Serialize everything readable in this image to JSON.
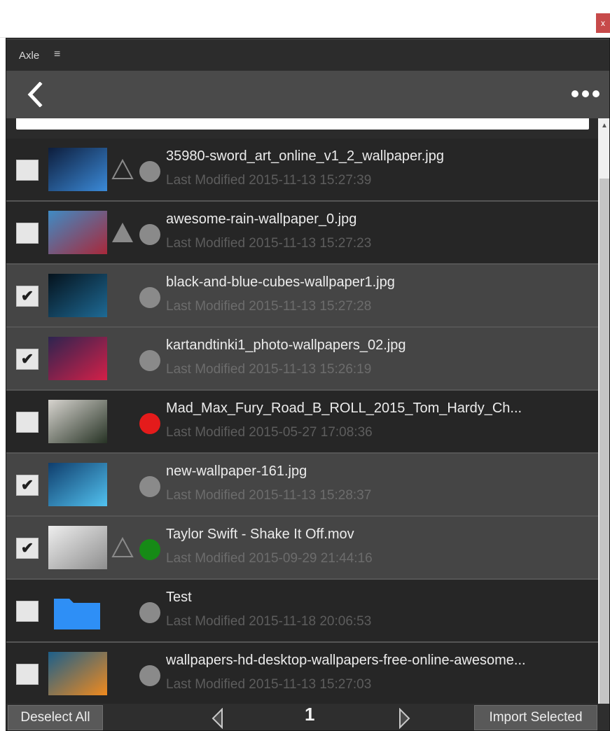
{
  "window": {
    "close_label": "x"
  },
  "panel": {
    "title": "Axle",
    "menu_glyph": "≡"
  },
  "toolbar": {
    "back_icon": "chevron-left-icon",
    "more_icon": "more-horizontal-icon"
  },
  "search": {
    "value": ""
  },
  "colors": {
    "dot_gray": "#8a8a8a",
    "dot_red": "#e41b1b",
    "dot_green": "#168a16",
    "folder_blue": "#2f8ff5"
  },
  "files": [
    {
      "name": "35980-sword_art_online_v1_2_wallpaper.jpg",
      "modified": "Last Modified 2015-11-13 15:27:39",
      "checked": false,
      "checkmark": "",
      "triangle": "outline",
      "status_color": "#8a8a8a",
      "thumb": [
        "#0d1d3c",
        "#3b8ad8"
      ]
    },
    {
      "name": "awesome-rain-wallpaper_0.jpg",
      "modified": "Last Modified 2015-11-13 15:27:23",
      "checked": false,
      "checkmark": "",
      "triangle": "filled",
      "status_color": "#8a8a8a",
      "thumb": [
        "#3f8bc4",
        "#a8283a"
      ]
    },
    {
      "name": "black-and-blue-cubes-wallpaper1.jpg",
      "modified": "Last Modified 2015-11-13 15:27:28",
      "checked": true,
      "checkmark": "✔",
      "triangle": "none",
      "status_color": "#8a8a8a",
      "thumb": [
        "#05121c",
        "#1e6a95"
      ]
    },
    {
      "name": "kartandtinki1_photo-wallpapers_02.jpg",
      "modified": "Last Modified 2015-11-13 15:26:19",
      "checked": true,
      "checkmark": "✔",
      "triangle": "none",
      "status_color": "#8a8a8a",
      "thumb": [
        "#2d2450",
        "#d42048"
      ]
    },
    {
      "name": "Mad_Max_Fury_Road_B_ROLL_2015_Tom_Hardy_Ch...",
      "modified": "Last Modified 2015-05-27 17:08:36",
      "checked": false,
      "checkmark": "",
      "triangle": "none",
      "status_color": "#e41b1b",
      "thumb": [
        "#d7d4cf",
        "#263224"
      ]
    },
    {
      "name": "new-wallpaper-161.jpg",
      "modified": "Last Modified 2015-11-13 15:28:37",
      "checked": true,
      "checkmark": "✔",
      "triangle": "none",
      "status_color": "#8a8a8a",
      "thumb": [
        "#0f3d6c",
        "#52c2f0"
      ]
    },
    {
      "name": "Taylor Swift - Shake It Off.mov",
      "modified": "Last Modified 2015-09-29 21:44:16",
      "checked": true,
      "checkmark": "✔",
      "triangle": "outline",
      "status_color": "#168a16",
      "thumb": [
        "#eeeeee",
        "#8e8e8e"
      ]
    },
    {
      "name": "Test",
      "modified": "Last Modified 2015-11-18 20:06:53",
      "checked": false,
      "checkmark": "",
      "triangle": "none",
      "status_color": "#8a8a8a",
      "thumb": "folder"
    },
    {
      "name": "wallpapers-hd-desktop-wallpapers-free-online-awesome...",
      "modified": "Last Modified 2015-11-13 15:27:03",
      "checked": false,
      "checkmark": "",
      "triangle": "none",
      "status_color": "#8a8a8a",
      "thumb": [
        "#1c5f8a",
        "#f08a1e"
      ]
    }
  ],
  "footer": {
    "deselect_label": "Deselect All",
    "page": "1",
    "import_label": "Import Selected",
    "prev_icon": "arrow-left-icon",
    "next_icon": "arrow-right-icon"
  }
}
